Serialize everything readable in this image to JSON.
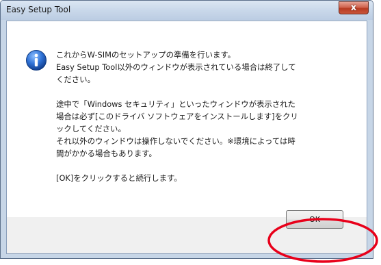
{
  "window": {
    "title": "Easy Setup Tool",
    "close_symbol": "x",
    "close_icon": "close-icon"
  },
  "message": {
    "icon": "info-icon",
    "paragraphs": [
      "これからW-SIMのセットアップの準備を行います。\nEasy Setup Tool以外のウィンドウが表示されている場合は終了して\nください。",
      "途中で「Windows セキュリティ」といったウィンドウが表示された\n場合は必ず[このドライバ ソフトウェアをインストールします]をクリ\nックしてください。\nそれ以外のウィンドウは操作しないでください。※環境によっては時\n間がかかる場合もあります。",
      "[OK]をクリックすると続行します。"
    ]
  },
  "buttons": {
    "ok_label": "OK"
  },
  "colors": {
    "annotation_ring": "#e8001a",
    "info_icon_blue": "#1f5fbf",
    "close_button_red": "#c9553b"
  }
}
